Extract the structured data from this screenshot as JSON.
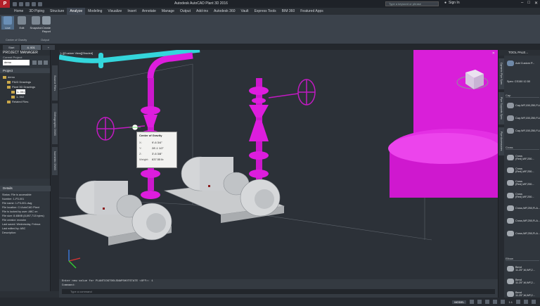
{
  "titlebar": {
    "logo": "P",
    "title": "Autodesk AutoCAD Plant 3D 2016",
    "search_placeholder": "Type a keyword or phrase",
    "signin": "Sign In",
    "window_buttons": [
      "–",
      "□",
      "✕"
    ]
  },
  "ribbon": {
    "tabs": [
      "Home",
      "3D Piping",
      "Structure",
      "Analyze",
      "Modeling",
      "Visualize",
      "Insert",
      "Annotate",
      "Manage",
      "Output",
      "Add-ins",
      "Autodesk 360",
      "Vault",
      "Express Tools",
      "BIM 360",
      "Featured Apps"
    ],
    "active_tab": 3,
    "buttons": [
      {
        "label": "Live",
        "active": true
      },
      {
        "label": "Edit",
        "active": false
      },
      {
        "label": "Snapshot",
        "active": false
      },
      {
        "label": "Create Report",
        "active": false
      }
    ],
    "group_labels": [
      "Center of Gravity",
      "Output"
    ]
  },
  "doc_tabs": [
    "Start",
    "4- 001",
    "+"
  ],
  "active_doc_tab": 1,
  "project_manager": {
    "title": "PROJECT MANAGER",
    "current_project_label": "Current Project:",
    "project_value": "demo",
    "section_project": "Project",
    "tree": [
      {
        "label": "demo",
        "level": 0,
        "selected": false
      },
      {
        "label": "P&ID Drawings",
        "level": 1,
        "selected": false
      },
      {
        "label": "Plant 3D Drawings",
        "level": 1,
        "selected": false
      },
      {
        "label": "1- 001",
        "level": 2,
        "selected": true
      },
      {
        "label": "1- 002",
        "level": 2,
        "selected": false
      },
      {
        "label": "Related Files",
        "level": 1,
        "selected": false
      }
    ],
    "details_title": "Details",
    "details": [
      "Status: File is accessible",
      "Number: 1-P3-001",
      "File name: 1-P3-001.dwg",
      "File location: C:\\AutoCAD Plant",
      "File is locked by user: ABC on",
      "File size: 8.48MB (8,897,713 bytes)",
      "File creator: mxxshn",
      "Last saved: Wednesday, Februa",
      "Last edited by: ABC",
      "Description:"
    ],
    "vertical_tabs": [
      "Source Files",
      "Orthographic DWG",
      "Isometric DWG"
    ]
  },
  "viewport": {
    "label": "[–][Custom View][Shaded]",
    "close": "✕",
    "cog_tooltip": {
      "title": "Center of Gravity",
      "rows": [
        {
          "key": "X:",
          "value": "9'-6 3/4\""
        },
        {
          "key": "Y:",
          "value": "28'-1 1/2\""
        },
        {
          "key": "Z:",
          "value": "3'-6 3/8\""
        },
        {
          "key": "Weight:",
          "value": "637.55 lb"
        }
      ]
    },
    "viewcube_label": "FRONT"
  },
  "command": {
    "lines": [
      "Enter new value for PLANTCOGTOOLSNAPSHOTSTATE <OFF>: 1",
      "Command:"
    ],
    "input_placeholder": "Type a command"
  },
  "tool_palette": {
    "title": "TOOL PALE...",
    "add_custom": "Add Custom P...",
    "spec_label": "Spec: CS150 12.50",
    "sections": [
      "Cap",
      "Cross",
      "Elbow"
    ],
    "vertical_tabs": [
      "Dynamic Pipe Spec",
      "Pipe Supports Spec",
      "Pipe Accessories"
    ],
    "cap_items": [
      "Cap,WF,150,250,FLA...",
      "Cap,WF,150,250,FLA...",
      "Cap,WF,150,250,FLA..."
    ],
    "cross_items": [
      "Cross (Red),WF,250...",
      "Cross (Red),WF,250...",
      "Cross (Red),WF,250...",
      "Cross (Red),WF,250...",
      "Cross,WF,250,FLA...",
      "Cross,WF,250,FLA...",
      "Cross,WF,250,FLA..."
    ],
    "elbow_items": [
      "Bend 11.25°,M,WF,2...",
      "Bend 11.25°,M,WF,2...",
      "Bend 11.25°,M,WF,2..."
    ]
  },
  "status_bar": {
    "model": "MODEL",
    "scale": "1:1",
    "icons": [
      "grid-icon",
      "snap-icon",
      "ortho-icon",
      "polar-icon",
      "osnap-icon",
      "annotation-icon",
      "workspace-icon",
      "settings-icon"
    ]
  },
  "colors": {
    "pipe_magenta": "#e020e0",
    "pipe_cyan": "#34d6dc",
    "pump_gray": "#c9cbcd",
    "background": "#2c3138"
  }
}
